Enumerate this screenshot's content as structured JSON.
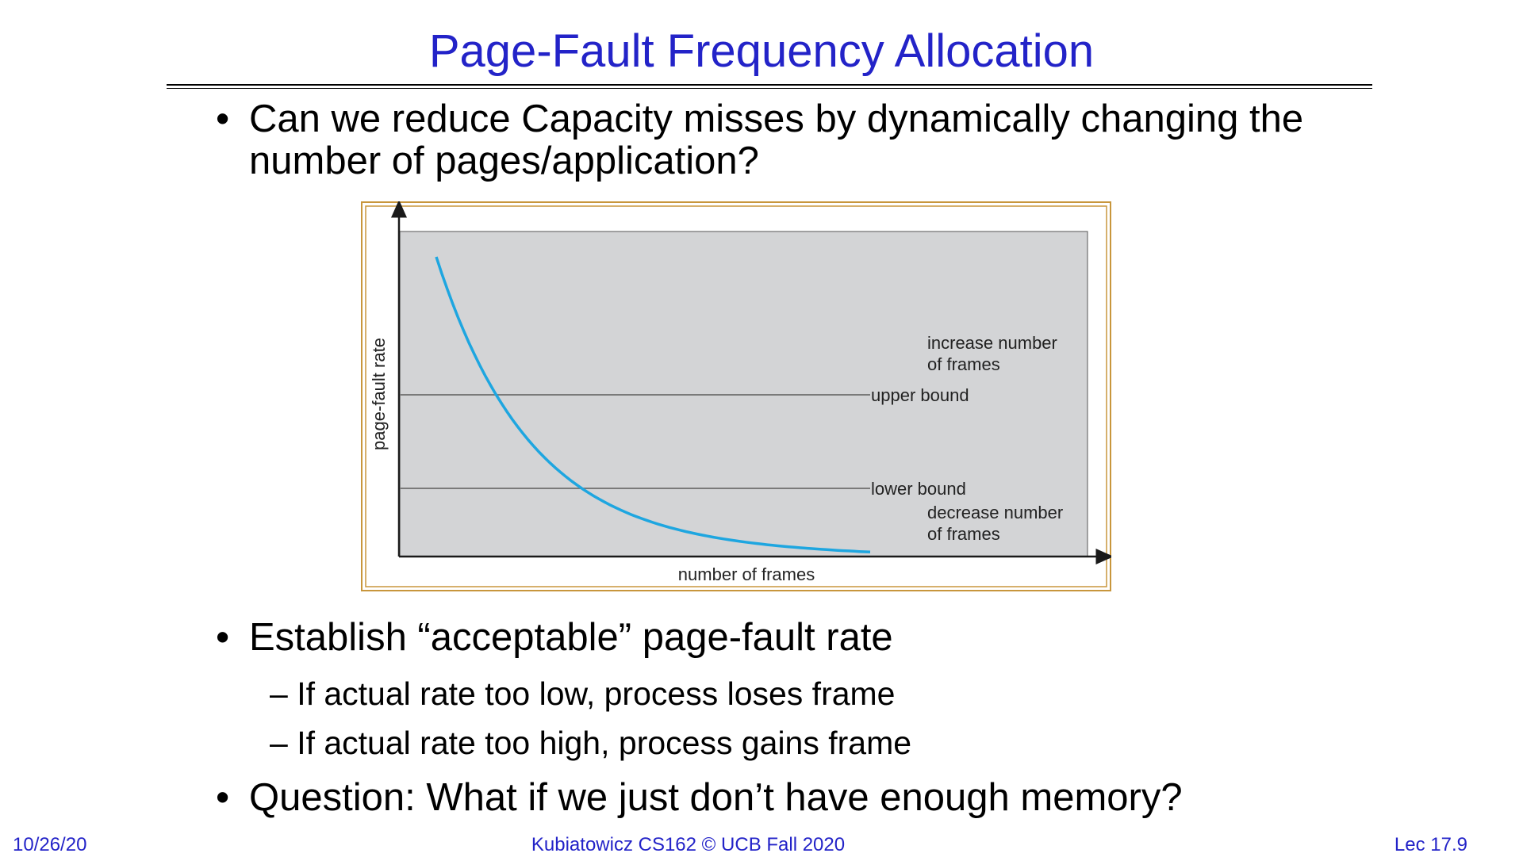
{
  "slide": {
    "title": "Page-Fault Frequency Allocation",
    "bullets": [
      {
        "line1": "Can we reduce Capacity misses by dynamically changing the",
        "line2": "number of pages/application?"
      },
      {
        "line1": "Establish “acceptable” page-fault rate"
      },
      {
        "line1": "Question: What if we just don’t have enough memory?"
      }
    ],
    "sub_bullets": [
      "– If actual rate too low, process loses frame",
      "– If actual rate too high, process gains frame"
    ],
    "bullet_symbol": "•"
  },
  "chart_data": {
    "type": "line",
    "xlabel": "number of frames",
    "ylabel": "page-fault rate",
    "upper_label": "upper bound",
    "lower_label": "lower bound",
    "increase_label_1": "increase number",
    "increase_label_2": "of frames",
    "decrease_label_1": "decrease number",
    "decrease_label_2": "of frames",
    "curve_color": "#1ea6e0",
    "plot_bg": "#d3d4d6",
    "frame_color": "#c8963c"
  },
  "footer": {
    "date": "10/26/20",
    "course": "Kubiatowicz CS162 © UCB Fall 2020",
    "lecture": "Lec 17.9"
  }
}
